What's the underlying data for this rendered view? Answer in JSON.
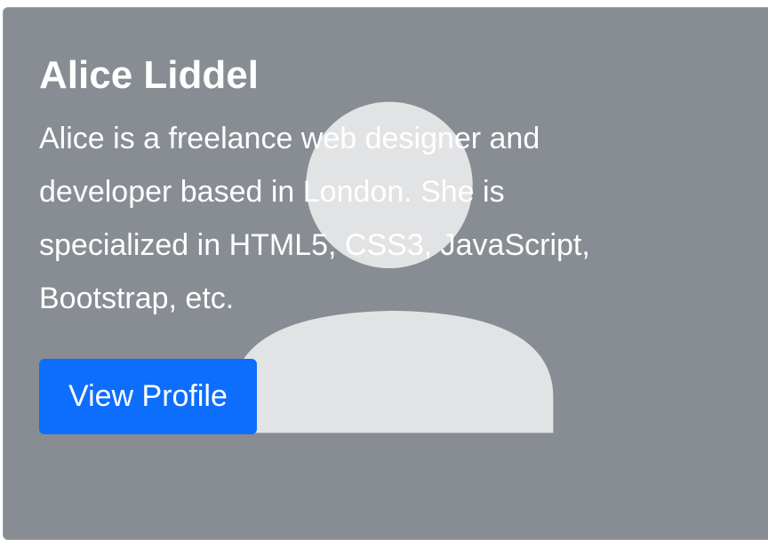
{
  "card": {
    "title": "Alice Liddel",
    "text": "Alice is a freelance web designer and developer based in London. She is specialized in HTML5, CSS3, JavaScript, Bootstrap, etc.",
    "button_label": "View Profile",
    "avatar_icon": "person-silhouette-icon"
  },
  "colors": {
    "card_background": "#878d93",
    "avatar_fill": "#e2e3e5",
    "button_background": "#0d6efd",
    "text": "#ffffff"
  }
}
